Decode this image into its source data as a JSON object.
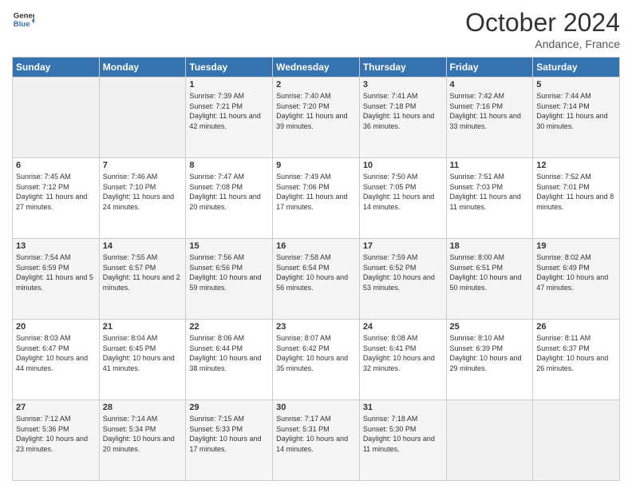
{
  "header": {
    "logo_line1": "General",
    "logo_line2": "Blue",
    "month": "October 2024",
    "location": "Andance, France"
  },
  "days_of_week": [
    "Sunday",
    "Monday",
    "Tuesday",
    "Wednesday",
    "Thursday",
    "Friday",
    "Saturday"
  ],
  "weeks": [
    [
      {
        "day": "",
        "sunrise": "",
        "sunset": "",
        "daylight": ""
      },
      {
        "day": "",
        "sunrise": "",
        "sunset": "",
        "daylight": ""
      },
      {
        "day": "1",
        "sunrise": "Sunrise: 7:39 AM",
        "sunset": "Sunset: 7:21 PM",
        "daylight": "Daylight: 11 hours and 42 minutes."
      },
      {
        "day": "2",
        "sunrise": "Sunrise: 7:40 AM",
        "sunset": "Sunset: 7:20 PM",
        "daylight": "Daylight: 11 hours and 39 minutes."
      },
      {
        "day": "3",
        "sunrise": "Sunrise: 7:41 AM",
        "sunset": "Sunset: 7:18 PM",
        "daylight": "Daylight: 11 hours and 36 minutes."
      },
      {
        "day": "4",
        "sunrise": "Sunrise: 7:42 AM",
        "sunset": "Sunset: 7:16 PM",
        "daylight": "Daylight: 11 hours and 33 minutes."
      },
      {
        "day": "5",
        "sunrise": "Sunrise: 7:44 AM",
        "sunset": "Sunset: 7:14 PM",
        "daylight": "Daylight: 11 hours and 30 minutes."
      }
    ],
    [
      {
        "day": "6",
        "sunrise": "Sunrise: 7:45 AM",
        "sunset": "Sunset: 7:12 PM",
        "daylight": "Daylight: 11 hours and 27 minutes."
      },
      {
        "day": "7",
        "sunrise": "Sunrise: 7:46 AM",
        "sunset": "Sunset: 7:10 PM",
        "daylight": "Daylight: 11 hours and 24 minutes."
      },
      {
        "day": "8",
        "sunrise": "Sunrise: 7:47 AM",
        "sunset": "Sunset: 7:08 PM",
        "daylight": "Daylight: 11 hours and 20 minutes."
      },
      {
        "day": "9",
        "sunrise": "Sunrise: 7:49 AM",
        "sunset": "Sunset: 7:06 PM",
        "daylight": "Daylight: 11 hours and 17 minutes."
      },
      {
        "day": "10",
        "sunrise": "Sunrise: 7:50 AM",
        "sunset": "Sunset: 7:05 PM",
        "daylight": "Daylight: 11 hours and 14 minutes."
      },
      {
        "day": "11",
        "sunrise": "Sunrise: 7:51 AM",
        "sunset": "Sunset: 7:03 PM",
        "daylight": "Daylight: 11 hours and 11 minutes."
      },
      {
        "day": "12",
        "sunrise": "Sunrise: 7:52 AM",
        "sunset": "Sunset: 7:01 PM",
        "daylight": "Daylight: 11 hours and 8 minutes."
      }
    ],
    [
      {
        "day": "13",
        "sunrise": "Sunrise: 7:54 AM",
        "sunset": "Sunset: 6:59 PM",
        "daylight": "Daylight: 11 hours and 5 minutes."
      },
      {
        "day": "14",
        "sunrise": "Sunrise: 7:55 AM",
        "sunset": "Sunset: 6:57 PM",
        "daylight": "Daylight: 11 hours and 2 minutes."
      },
      {
        "day": "15",
        "sunrise": "Sunrise: 7:56 AM",
        "sunset": "Sunset: 6:56 PM",
        "daylight": "Daylight: 10 hours and 59 minutes."
      },
      {
        "day": "16",
        "sunrise": "Sunrise: 7:58 AM",
        "sunset": "Sunset: 6:54 PM",
        "daylight": "Daylight: 10 hours and 56 minutes."
      },
      {
        "day": "17",
        "sunrise": "Sunrise: 7:59 AM",
        "sunset": "Sunset: 6:52 PM",
        "daylight": "Daylight: 10 hours and 53 minutes."
      },
      {
        "day": "18",
        "sunrise": "Sunrise: 8:00 AM",
        "sunset": "Sunset: 6:51 PM",
        "daylight": "Daylight: 10 hours and 50 minutes."
      },
      {
        "day": "19",
        "sunrise": "Sunrise: 8:02 AM",
        "sunset": "Sunset: 6:49 PM",
        "daylight": "Daylight: 10 hours and 47 minutes."
      }
    ],
    [
      {
        "day": "20",
        "sunrise": "Sunrise: 8:03 AM",
        "sunset": "Sunset: 6:47 PM",
        "daylight": "Daylight: 10 hours and 44 minutes."
      },
      {
        "day": "21",
        "sunrise": "Sunrise: 8:04 AM",
        "sunset": "Sunset: 6:45 PM",
        "daylight": "Daylight: 10 hours and 41 minutes."
      },
      {
        "day": "22",
        "sunrise": "Sunrise: 8:06 AM",
        "sunset": "Sunset: 6:44 PM",
        "daylight": "Daylight: 10 hours and 38 minutes."
      },
      {
        "day": "23",
        "sunrise": "Sunrise: 8:07 AM",
        "sunset": "Sunset: 6:42 PM",
        "daylight": "Daylight: 10 hours and 35 minutes."
      },
      {
        "day": "24",
        "sunrise": "Sunrise: 8:08 AM",
        "sunset": "Sunset: 6:41 PM",
        "daylight": "Daylight: 10 hours and 32 minutes."
      },
      {
        "day": "25",
        "sunrise": "Sunrise: 8:10 AM",
        "sunset": "Sunset: 6:39 PM",
        "daylight": "Daylight: 10 hours and 29 minutes."
      },
      {
        "day": "26",
        "sunrise": "Sunrise: 8:11 AM",
        "sunset": "Sunset: 6:37 PM",
        "daylight": "Daylight: 10 hours and 26 minutes."
      }
    ],
    [
      {
        "day": "27",
        "sunrise": "Sunrise: 7:12 AM",
        "sunset": "Sunset: 5:36 PM",
        "daylight": "Daylight: 10 hours and 23 minutes."
      },
      {
        "day": "28",
        "sunrise": "Sunrise: 7:14 AM",
        "sunset": "Sunset: 5:34 PM",
        "daylight": "Daylight: 10 hours and 20 minutes."
      },
      {
        "day": "29",
        "sunrise": "Sunrise: 7:15 AM",
        "sunset": "Sunset: 5:33 PM",
        "daylight": "Daylight: 10 hours and 17 minutes."
      },
      {
        "day": "30",
        "sunrise": "Sunrise: 7:17 AM",
        "sunset": "Sunset: 5:31 PM",
        "daylight": "Daylight: 10 hours and 14 minutes."
      },
      {
        "day": "31",
        "sunrise": "Sunrise: 7:18 AM",
        "sunset": "Sunset: 5:30 PM",
        "daylight": "Daylight: 10 hours and 11 minutes."
      },
      {
        "day": "",
        "sunrise": "",
        "sunset": "",
        "daylight": ""
      },
      {
        "day": "",
        "sunrise": "",
        "sunset": "",
        "daylight": ""
      }
    ]
  ]
}
